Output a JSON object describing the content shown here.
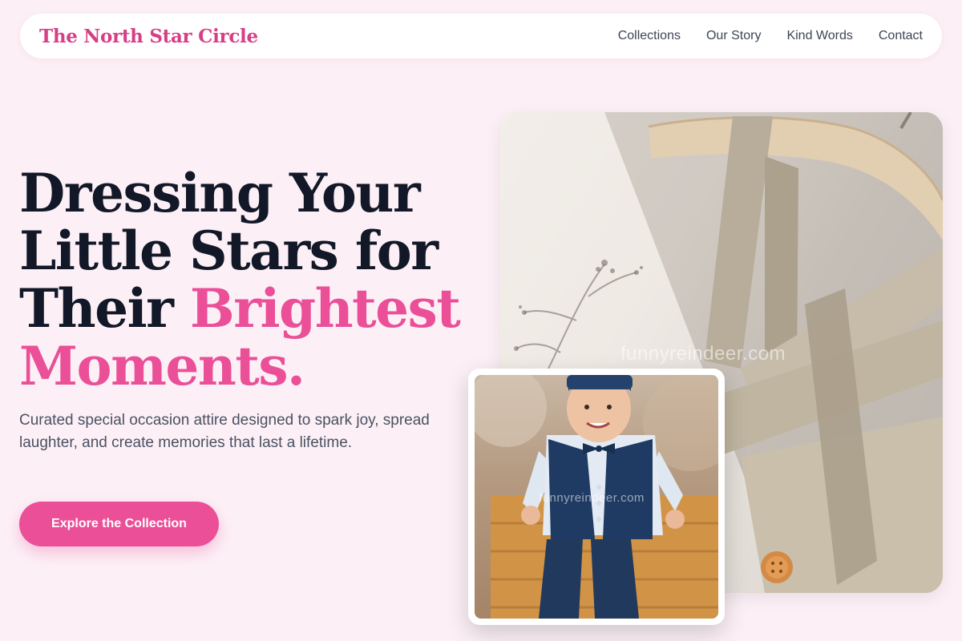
{
  "brand": {
    "name": "The North Star Circle"
  },
  "nav": {
    "links": [
      {
        "label": "Collections"
      },
      {
        "label": "Our Story"
      },
      {
        "label": "Kind Words"
      },
      {
        "label": "Contact"
      }
    ]
  },
  "hero": {
    "title_dark": "Dressing Your Little Stars for Their",
    "title_accent": "Brightest Moments.",
    "subtitle": "Curated special occasion attire designed to spark joy, spread laughter, and create memories that last a lifetime.",
    "cta_label": "Explore the Collection"
  },
  "images": {
    "main_watermark": "funnyreindeer.com",
    "inset_watermark": "funnyreindeer.com"
  },
  "colors": {
    "accent": "#ea4f98",
    "brand": "#d63f86",
    "background": "#fcf0f6",
    "heading": "#121827"
  }
}
